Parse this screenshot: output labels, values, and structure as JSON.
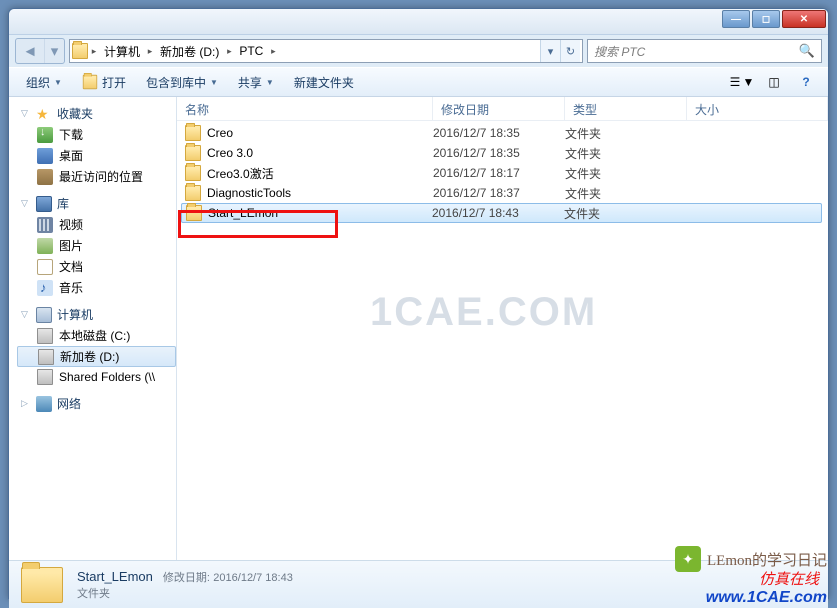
{
  "titlebar": {
    "min": "—",
    "max": "◻",
    "close": "✕"
  },
  "address": {
    "crumbs": [
      "计算机",
      "新加卷 (D:)",
      "PTC"
    ],
    "separator": "▸",
    "dropdown": "▾",
    "refresh": "↻"
  },
  "search": {
    "placeholder": "搜索 PTC"
  },
  "toolbar": {
    "organize": "组织",
    "open": "打开",
    "include": "包含到库中",
    "share": "共享",
    "newfolder": "新建文件夹"
  },
  "nav": {
    "favorites": "收藏夹",
    "downloads": "下载",
    "desktop": "桌面",
    "recent": "最近访问的位置",
    "library": "库",
    "videos": "视频",
    "pictures": "图片",
    "documents": "文档",
    "music": "音乐",
    "computer": "计算机",
    "driveC": "本地磁盘 (C:)",
    "driveD": "新加卷 (D:)",
    "shared": "Shared Folders (\\\\",
    "network": "网络"
  },
  "columns": {
    "name": "名称",
    "date": "修改日期",
    "type": "类型",
    "size": "大小"
  },
  "rows": [
    {
      "name": "Creo",
      "date": "2016/12/7 18:35",
      "type": "文件夹"
    },
    {
      "name": "Creo 3.0",
      "date": "2016/12/7 18:35",
      "type": "文件夹"
    },
    {
      "name": "Creo3.0激活",
      "date": "2016/12/7 18:17",
      "type": "文件夹"
    },
    {
      "name": "DiagnosticTools",
      "date": "2016/12/7 18:37",
      "type": "文件夹"
    },
    {
      "name": "Start_LEmon",
      "date": "2016/12/7 18:43",
      "type": "文件夹",
      "selected": true
    }
  ],
  "details": {
    "name": "Start_LEmon",
    "mod_label": "修改日期:",
    "mod_val": "2016/12/7 18:43",
    "type": "文件夹"
  },
  "watermark": "1CAE.COM",
  "footer_brand": "LEmon的学习日记",
  "footer_url1": "仿真在线",
  "footer_url2": "www.1CAE.com"
}
